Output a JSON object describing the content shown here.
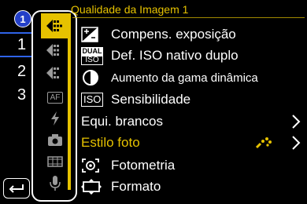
{
  "menu": {
    "title": "Qualidade da Imagem 1",
    "items": [
      {
        "label": "Compens. exposição",
        "icon": "exposure-compensation-icon"
      },
      {
        "label": "Def. ISO nativo duplo",
        "icon": "dual-iso-icon",
        "icon_text_top": "DUAL",
        "icon_text_bottom": "ISO"
      },
      {
        "label": "Aumento da gama dinâmica",
        "icon": "dynamic-range-icon"
      },
      {
        "label": "Sensibilidade",
        "icon": "iso-icon",
        "icon_text": "ISO"
      },
      {
        "label": "Equi. brancos",
        "icon": "none"
      },
      {
        "label": "Estilo foto",
        "icon": "none",
        "selected": true
      },
      {
        "label": "Fotometria",
        "icon": "metering-icon"
      },
      {
        "label": "Formato",
        "icon": "aspect-ratio-icon"
      }
    ]
  },
  "pages": {
    "current": "1",
    "numbers": [
      "1",
      "2",
      "3"
    ]
  },
  "tabs": [
    {
      "name": "photo-quality-tab-active",
      "active": true
    },
    {
      "name": "photo-quality-tab-2"
    },
    {
      "name": "photo-quality-tab-3"
    },
    {
      "name": "af-tab",
      "text": "AF"
    },
    {
      "name": "flash-tab"
    },
    {
      "name": "camera-tab"
    },
    {
      "name": "video-tab"
    },
    {
      "name": "audio-tab"
    }
  ],
  "colors": {
    "accent": "#e6c200",
    "page_blue": "#2f63e8"
  }
}
